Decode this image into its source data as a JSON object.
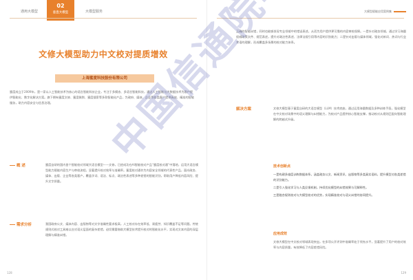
{
  "nav": {
    "tab_left": "通用大模型",
    "tab_active_num": "02",
    "tab_active_label": "垂直大模型",
    "tab_right": "大模型服务"
  },
  "header_right": {
    "title": "大模型赋能应用案例集"
  },
  "left_page": {
    "title": "文修大模型助力中文校对提质增效",
    "company": "上海蜜度科技股份有限公司",
    "intro": "蜜度成立于2009年，是一家以人工智能技术为核心的语言智能科技企业，专注于多模态、多语言智能科技，通过人工智能与大数据技术为客户提供智能化、数字化解决方案。旗下拥有蜜度文修、蜜度微舆、蜜度搜索等多款智能化产品，为政府、媒体、企业等各类客户提供高效、精准的智能服务，助力内容安全与信息治理。",
    "overview_label": "概 述",
    "overview_text": "蜜度自研的国内首个智能校对领域大语言模型——文修，已经成功在AI智能校对产品“蜜度校对通”中落地，运用大语言模型能力赋能内容生产与审校流程，显著提升校对效率与准确率。蜜度校对通作为内容安全领域的代表性产品，面向政务、媒体、出版、企业等各类客户，覆盖字词、语法、标点、政治性表述等多种差错的智能识别，帮助用户降低内容风险、提升文字质量。",
    "needs_label": "需求分析",
    "needs_text": "我国政府公文、媒体内容、出版物等对文字准确性要求极高，人工校对存在效率低、易疲劳、知识覆盖不足等问题。传统规则式校对工具难以应对语义层面的复杂差错，迫切需要借助大模型技术提升校对的智能化水平，实现对文本内容的深层理解与精准纠错。",
    "page_number": "128"
  },
  "right_page": {
    "top_text": "正确的智能纠错，同时也能够发现专业领域中的错误表述，从而为用户提供更可靠的内容审校保障。一是针对政务领域，通过学习海量权威政策文件、规范表述，提升对政治性表述、法律法规引用等内容的识别能力；二是针对出版与媒体领域，强化对新词、热词与行业术语的理解，形成覆盖多场景的校对能力体系。",
    "plan_label": "解决方案",
    "plan_text": "文修大模型基于蜜度自研的大语言模型（LLM）技术底座，通过运用海量数据及多种训练手段，强化模型在中文校对场景中的语义理解与纠错能力，为校对产品提供核心智能支撑，推动校对从规则匹配向智能理解的跨越式升级。",
    "sub1": "技术创新点",
    "bullets": [
      "一是构建多维度训练数据体系，涵盖政务公文、新闻资讯、出版物等多类真实语料，提升模型对各类差错的识别能力。",
      "二是引入强化学习与人类反馈机制，持续优化模型的纠错效果与可解释性。",
      "三是融合规则校对与大模型校对的优势，实现精准校对与语义纠错的协同提升。"
    ],
    "sub2": "应用成效",
    "impact_text": "文修大模型在中文校对领域表现突出，在多项公开评测中准确率处于领先水平，显著提升了用户的校对效率与内容质量，有效降低了内容差错风险。",
    "page_number": "129"
  },
  "watermark": "中国信通院华东分院"
}
